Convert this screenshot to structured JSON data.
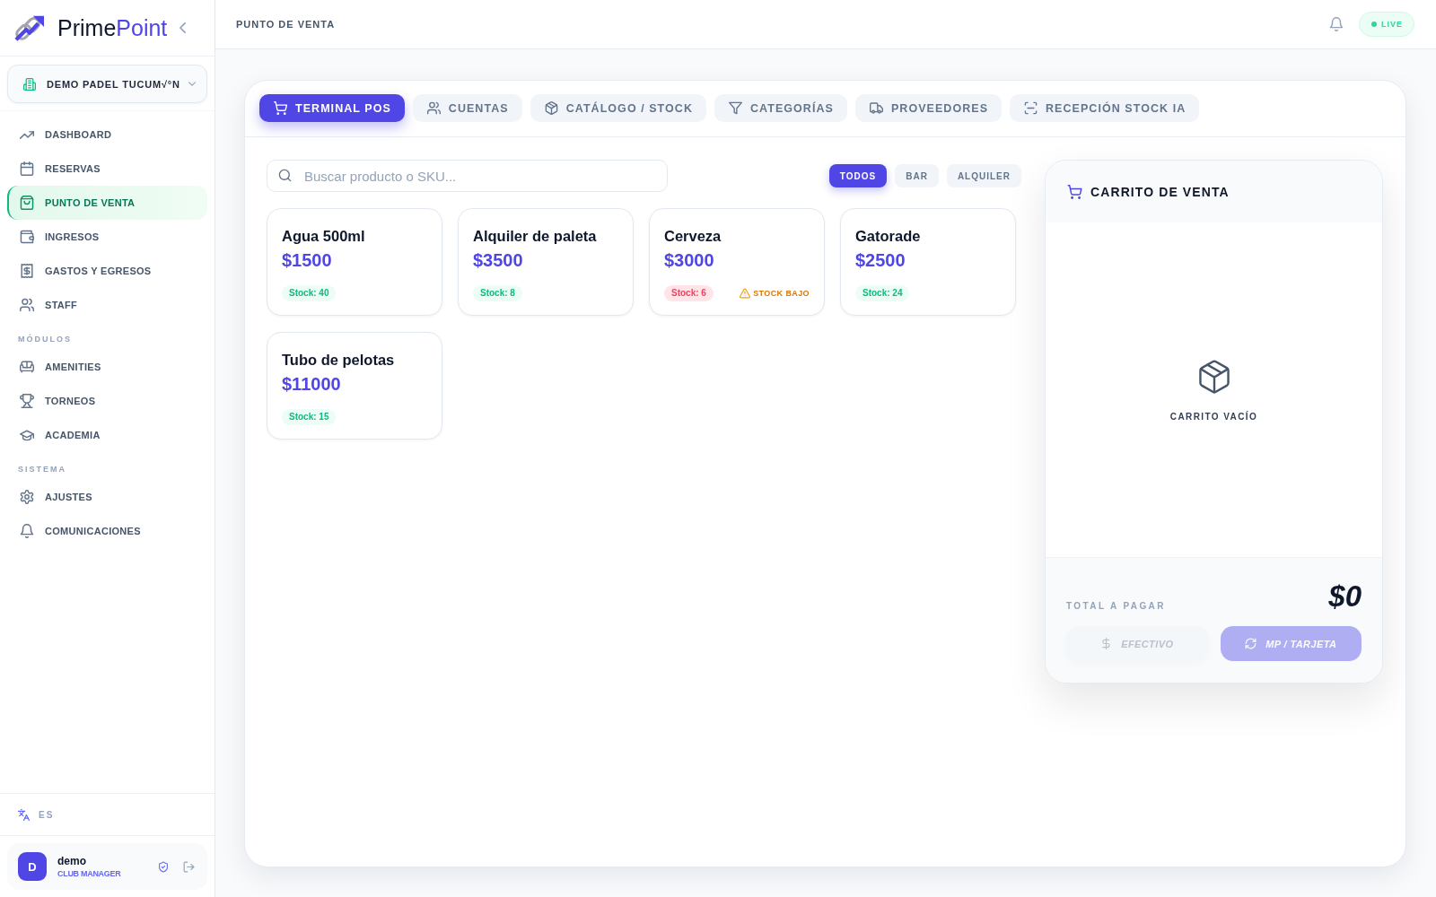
{
  "sidebar": {
    "brand": {
      "lead": "Prime",
      "accent": "Point"
    },
    "club_selector": {
      "label": "DEMO PADEL TUCUM√°N"
    },
    "nav_groups": [
      {
        "items": [
          {
            "label": "DASHBOARD",
            "selected": false
          },
          {
            "label": "RESERVAS",
            "selected": false
          },
          {
            "label": "PUNTO DE VENTA",
            "selected": true
          },
          {
            "label": "INGRESOS",
            "selected": false
          },
          {
            "label": "GASTOS Y EGRESOS",
            "selected": false
          },
          {
            "label": "STAFF",
            "selected": false
          }
        ]
      },
      {
        "heading": "MÓDULOS",
        "items": [
          {
            "label": "AMENITIES",
            "selected": false
          },
          {
            "label": "TORNEOS",
            "selected": false
          },
          {
            "label": "ACADEMIA",
            "selected": false
          }
        ]
      },
      {
        "heading": "SISTEMA",
        "items": [
          {
            "label": "AJUSTES",
            "selected": false
          },
          {
            "label": "COMUNICACIONES",
            "selected": false
          }
        ]
      }
    ],
    "language": {
      "label": "ES"
    },
    "user": {
      "initial": "D",
      "name": "demo",
      "role": "CLUB MANAGER"
    }
  },
  "topbar": {
    "title": "PUNTO DE VENTA",
    "status": "LIVE"
  },
  "tabs": [
    {
      "label": "TERMINAL POS",
      "selected": true
    },
    {
      "label": "CUENTAS",
      "selected": false
    },
    {
      "label": "CATÁLOGO / STOCK",
      "selected": false
    },
    {
      "label": "CATEGORÍAS",
      "selected": false
    },
    {
      "label": "PROVEEDORES",
      "selected": false
    },
    {
      "label": "RECEPCIÓN STOCK IA",
      "selected": false
    }
  ],
  "search": {
    "placeholder": "Buscar producto o SKU..."
  },
  "filters": [
    {
      "label": "TODOS",
      "selected": true
    },
    {
      "label": "BAR",
      "selected": false
    },
    {
      "label": "ALQUILER",
      "selected": false
    }
  ],
  "products": [
    {
      "name": "Agua 500ml",
      "price": "$1500",
      "stock": "Stock: 40",
      "low_stock": false
    },
    {
      "name": "Alquiler de paleta",
      "price": "$3500",
      "stock": "Stock: 8",
      "low_stock": false
    },
    {
      "name": "Cerveza",
      "price": "$3000",
      "stock": "Stock: 6",
      "low_stock": true,
      "warning": "STOCK BAJO"
    },
    {
      "name": "Gatorade",
      "price": "$2500",
      "stock": "Stock: 24",
      "low_stock": false
    },
    {
      "name": "Tubo de pelotas",
      "price": "$11000",
      "stock": "Stock: 15",
      "low_stock": false
    }
  ],
  "cart": {
    "title": "CARRITO DE VENTA",
    "empty_message": "CARRITO VACÍO",
    "total_label": "TOTAL A PAGAR",
    "total": "$0",
    "payment_buttons": [
      {
        "kind": "cash",
        "label": "EFECTIVO",
        "disabled": true
      },
      {
        "kind": "card",
        "label": "MP / TARJETA",
        "disabled": true
      }
    ]
  }
}
